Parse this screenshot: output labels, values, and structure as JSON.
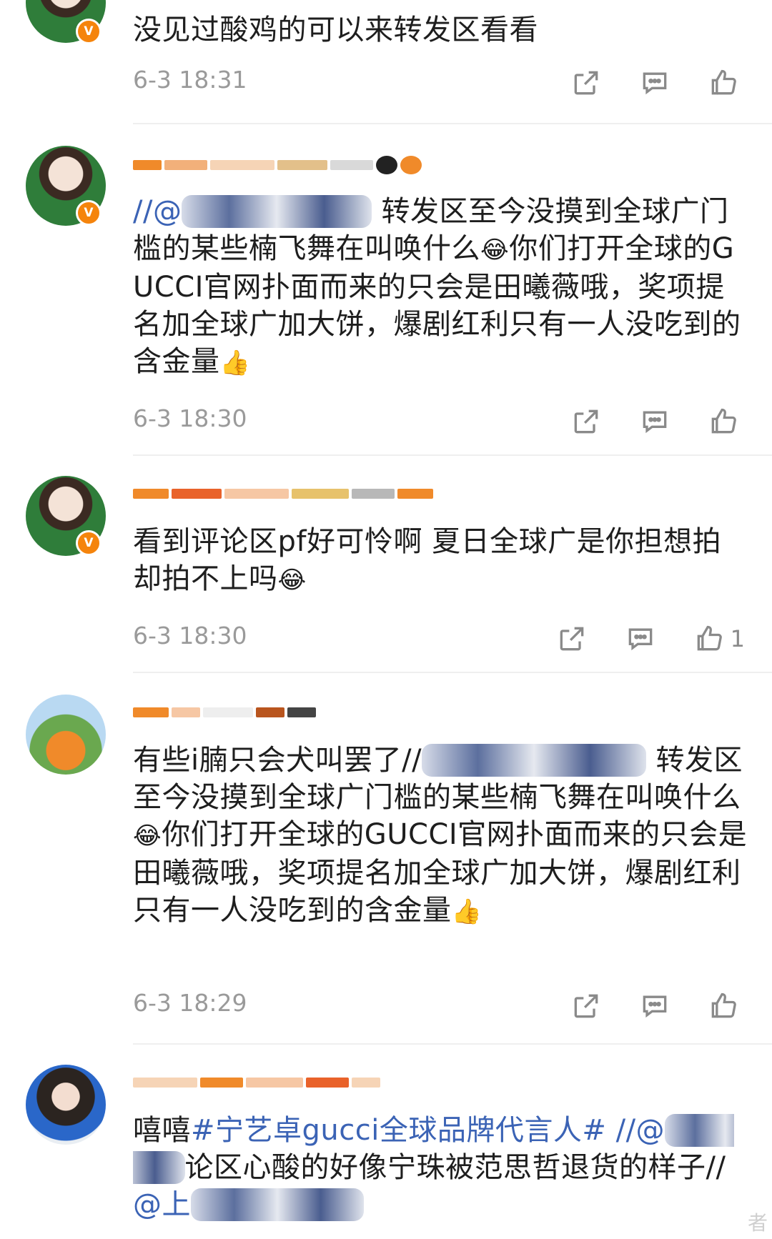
{
  "comments": [
    {
      "text": "没见过酸鸡的可以来转发区看看",
      "time": "6-3 18:31",
      "likes": ""
    },
    {
      "text_parts": [
        "//@",
        " 转发区至今没摸到全球广门槛的某些楠飞舞在叫唤什么",
        "😂",
        "你们打开全球的GUCCI官网扑面而来的只会是田曦薇哦，奖项提名加全球广加大饼，爆剧红利只有一人没吃到的含金量",
        "👍"
      ],
      "time": "6-3 18:30",
      "likes": ""
    },
    {
      "text_parts": [
        "看到评论区pf好可怜啊 夏日全球广是你担想拍却拍不上吗",
        "😂"
      ],
      "time": "6-3 18:30",
      "likes": "1"
    },
    {
      "text_parts": [
        "有些i腩只会犬叫罢了//",
        " 转发区至今没摸到全球广门槛的某些楠飞舞在叫唤什么",
        "😂",
        "你们打开全球的GUCCI官网扑面而来的只会是田曦薇哦，奖项提名加全球广加大饼，爆剧红利只有一人没吃到的含金量",
        "👍"
      ],
      "time": "6-3 18:29",
      "likes": ""
    },
    {
      "text_parts": [
        "嘻嘻",
        "#宁艺卓gucci全球品牌代言人#",
        " //@",
        "论区心酸的好像宁珠被范思哲退货的样子//",
        "@上"
      ],
      "time": "",
      "likes": ""
    }
  ],
  "watermark": "者"
}
